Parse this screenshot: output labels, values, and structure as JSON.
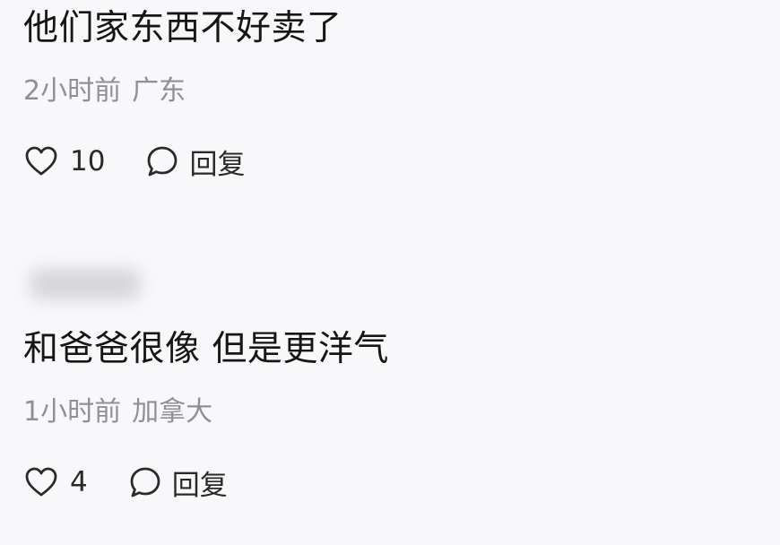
{
  "comments": [
    {
      "content": "他们家东西不好卖了",
      "time": "2小时前",
      "location": "广东",
      "likes": "10",
      "reply_label": "回复"
    },
    {
      "content": "和爸爸很像 但是更洋气",
      "time": "1小时前",
      "location": "加拿大",
      "likes": "4",
      "reply_label": "回复"
    }
  ],
  "colors": {
    "background": "#f8f8fa",
    "text": "#161616",
    "meta": "#8f8f98",
    "icon": "#2a2a2a"
  },
  "icons": {
    "like": "heart-outline-icon",
    "reply": "speech-bubble-icon"
  }
}
